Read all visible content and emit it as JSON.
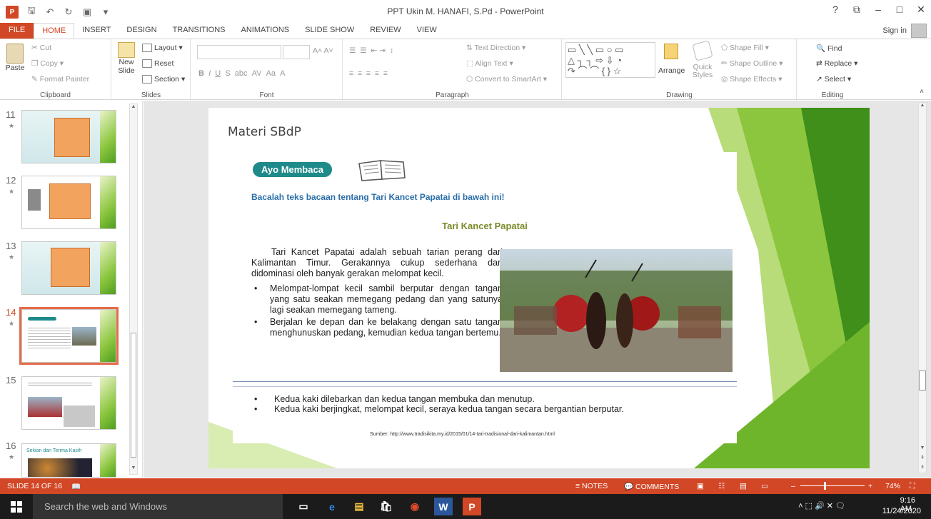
{
  "window": {
    "title": "PPT Ukin M. HANAFI, S.Pd - PowerPoint",
    "controls": [
      "?",
      "⧉",
      "–",
      "□",
      "✕"
    ]
  },
  "tabs": [
    "FILE",
    "HOME",
    "INSERT",
    "DESIGN",
    "TRANSITIONS",
    "ANIMATIONS",
    "SLIDE SHOW",
    "REVIEW",
    "VIEW"
  ],
  "signin": "Sign in",
  "ribbon": {
    "clipboard": {
      "label": "Clipboard",
      "paste": "Paste",
      "cut": "Cut",
      "copy": "Copy",
      "format_painter": "Format Painter"
    },
    "slides": {
      "label": "Slides",
      "new_slide": "New Slide",
      "layout": "Layout",
      "reset": "Reset",
      "section": "Section"
    },
    "font": {
      "label": "Font"
    },
    "paragraph": {
      "label": "Paragraph",
      "text_direction": "Text Direction",
      "align_text": "Align Text",
      "convert": "Convert to SmartArt"
    },
    "drawing": {
      "label": "Drawing",
      "arrange": "Arrange",
      "quick_styles": "Quick Styles",
      "shape_fill": "Shape Fill",
      "shape_outline": "Shape Outline",
      "shape_effects": "Shape Effects"
    },
    "editing": {
      "label": "Editing",
      "find": "Find",
      "replace": "Replace",
      "select": "Select"
    }
  },
  "thumbnails": [
    {
      "num": "11",
      "star": "★"
    },
    {
      "num": "12",
      "star": "★"
    },
    {
      "num": "13",
      "star": "★"
    },
    {
      "num": "14",
      "star": "★"
    },
    {
      "num": "15",
      "star": ""
    },
    {
      "num": "16",
      "star": "★",
      "caption": "Sekian dan Terima Kasih"
    }
  ],
  "slide": {
    "title": "Materi SBdP",
    "ayo": "Ayo Membaca",
    "instruction": "Bacalah teks bacaan tentang Tari Kancet Papatai di bawah ini!",
    "heading": "Tari Kancet Papatai",
    "paragraph": "Tari Kancet Papatai adalah sebuah tarian perang dari Kalimantan Timur. Gerakannya cukup sederhana dan didominasi oleh banyak gerakan melompat kecil.",
    "bullets_left": [
      "Melompat-lompat kecil sambil berputar dengan tangan yang satu seakan memegang pedang dan yang satunya lagi seakan memegang tameng.",
      "Berjalan ke depan dan ke belakang dengan satu tangan menghunuskan pedang, kemudian kedua tangan bertemu."
    ],
    "bullets_bottom": [
      "Kedua kaki dilebarkan dan kedua tangan membuka dan menutup.",
      "Kedua kaki berjingkat, melompat kecil, seraya kedua tangan secara bergantian berputar."
    ],
    "source": "Sumber: http://www.tradisikita.my.id/2015/01/14-tari-tradisional-dari-kalimantan.html"
  },
  "status": {
    "slide_info": "SLIDE 14 OF 16",
    "notes": "NOTES",
    "comments": "COMMENTS",
    "zoom": "74%"
  },
  "taskbar": {
    "search_placeholder": "Search the web and Windows",
    "time": "9:16 AM",
    "date": "11/24/2020"
  },
  "colors": {
    "accent": "#d24726",
    "teal": "#1f8a8a",
    "green": "#8cc63f"
  }
}
